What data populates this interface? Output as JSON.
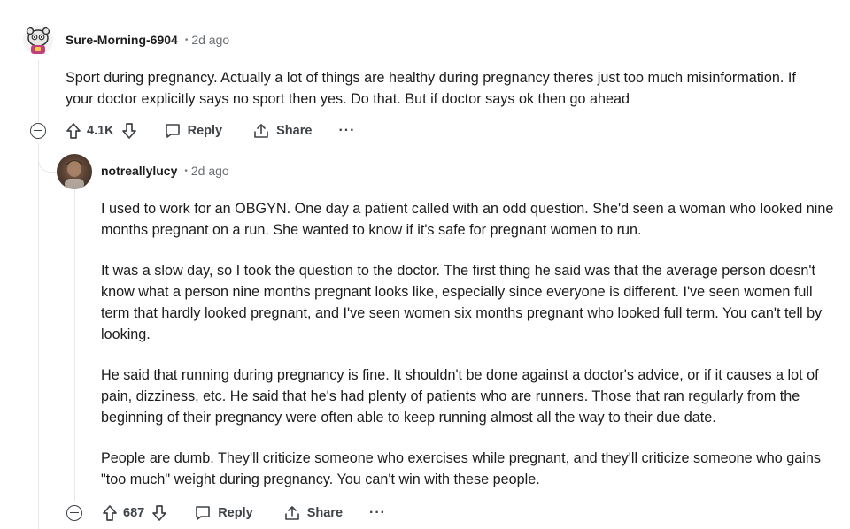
{
  "comments": [
    {
      "username": "Sure-Morning-6904",
      "separator": "•",
      "time": "2d ago",
      "paragraphs": [
        "Sport during pregnancy. Actually a lot of things are healthy during pregnancy theres just too much misinformation. If your doctor explicitly says no sport then yes. Do that. But if doctor says ok then go ahead"
      ],
      "score": "4.1K",
      "reply_label": "Reply",
      "share_label": "Share",
      "more_label": "···"
    },
    {
      "username": "notreallylucy",
      "separator": "•",
      "time": "2d ago",
      "paragraphs": [
        "I used to work for an OBGYN. One day a patient called with an odd question. She'd seen a woman who looked nine months pregnant on a run. She wanted to know if it's safe for pregnant women to run.",
        "It was a slow day, so I took the question to the doctor. The first thing he said was that the average person doesn't know what a person nine months pregnant looks like, especially since everyone is different. I've seen women full term that hardly looked pregnant, and I've seen women six months pregnant who looked full term. You can't tell by looking.",
        "He said that running during pregnancy is fine. It shouldn't be done against a doctor's advice, or if it causes a lot of pain, dizziness, etc. He said that he's had plenty of patients who are runners. Those that ran regularly from the beginning of their pregnancy were often able to keep running almost all the way to their due date.",
        "People are dumb. They'll criticize someone who exercises while pregnant, and they'll criticize someone who gains \"too much\" weight during pregnancy. You can't win with these people."
      ],
      "score": "687",
      "reply_label": "Reply",
      "share_label": "Share",
      "more_label": "···"
    }
  ],
  "icons": {
    "collapse": "collapse-icon",
    "upvote": "upvote-arrow-icon",
    "downvote": "downvote-arrow-icon",
    "reply": "speech-bubble-icon",
    "share": "share-arrow-icon"
  }
}
